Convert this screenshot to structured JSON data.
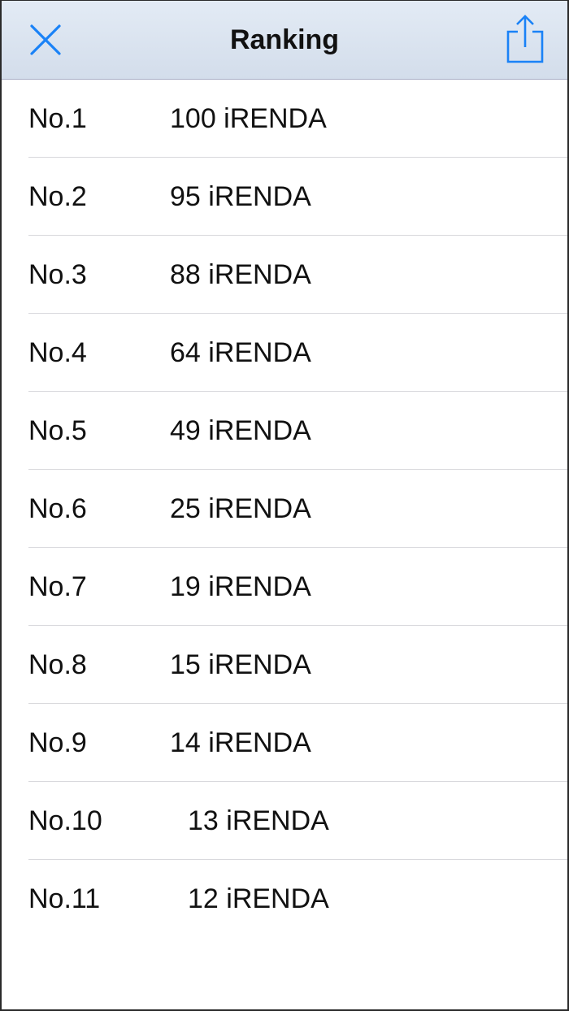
{
  "navbar": {
    "title": "Ranking",
    "close_icon": "close-icon",
    "share_icon": "share-icon",
    "accent_color": "#1a82f7"
  },
  "ranking": [
    {
      "rank": "No.1",
      "score": "100 iRENDA"
    },
    {
      "rank": "No.2",
      "score": "95 iRENDA"
    },
    {
      "rank": "No.3",
      "score": "88 iRENDA"
    },
    {
      "rank": "No.4",
      "score": "64 iRENDA"
    },
    {
      "rank": "No.5",
      "score": "49 iRENDA"
    },
    {
      "rank": "No.6",
      "score": "25 iRENDA"
    },
    {
      "rank": "No.7",
      "score": "19 iRENDA"
    },
    {
      "rank": "No.8",
      "score": "15 iRENDA"
    },
    {
      "rank": "No.9",
      "score": "14 iRENDA"
    },
    {
      "rank": "No.10",
      "score": "13 iRENDA"
    },
    {
      "rank": "No.11",
      "score": "12 iRENDA"
    }
  ]
}
